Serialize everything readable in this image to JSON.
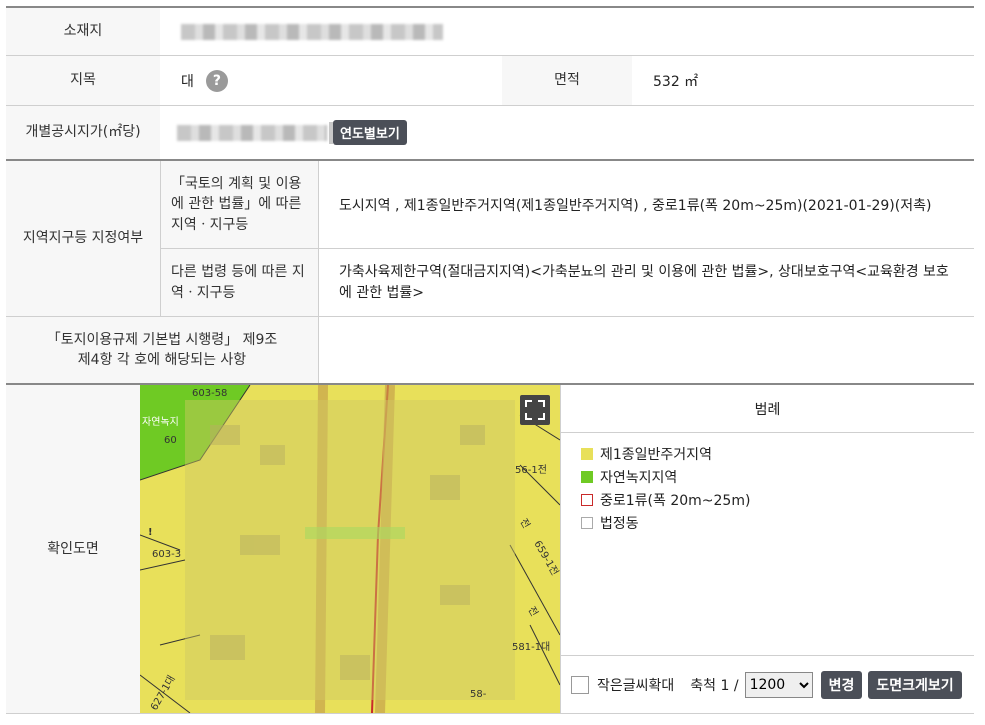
{
  "rows": {
    "location": {
      "label": "소재지"
    },
    "land_category": {
      "label": "지목",
      "value": "대",
      "help_symbol": "?"
    },
    "area": {
      "label": "면적",
      "value": "532 ㎡"
    },
    "official_price": {
      "label": "개별공시지가(㎡당)",
      "button": "연도별보기"
    },
    "zoning": {
      "label": "지역지구등 지정여부",
      "national_label": "「국토의 계획 및 이용에 관한 법률」에 따른 지역ㆍ지구등",
      "national_value": "도시지역 , 제1종일반주거지역(제1종일반주거지역) , 중로1류(폭 20m~25m)(2021-01-29)(저촉)",
      "other_label": "다른 법령 등에 따른 지역ㆍ지구등",
      "other_value": "가축사육제한구역(절대금지지역)<가축분뇨의 관리 및 이용에 관한 법률>, 상대보호구역<교육환경 보호에 관한 법률>"
    },
    "enforcement": {
      "label": "「토지이용규제 기본법 시행령」 제9조 제4항 각 호에 해당되는 사항"
    },
    "map": {
      "label": "확인도면"
    }
  },
  "map_labels": {
    "l1": "603-58",
    "l2": "자연녹지",
    "l3": "60",
    "l4": "603-3",
    "l5": "56-1전",
    "l6": "전",
    "l7": "659-1전",
    "l8": "전",
    "l9": "581-1대",
    "l10": "627-1대",
    "l11": "58-"
  },
  "legend": {
    "title": "범례",
    "items": [
      {
        "label": "제1종일반주거지역",
        "fill": "#e8e05a",
        "border": "#e8e05a"
      },
      {
        "label": "자연녹지지역",
        "fill": "#6fca24",
        "border": "#6fca24"
      },
      {
        "label": "중로1류(폭 20m~25m)",
        "fill": "#ffffff",
        "border": "#c92a2a"
      },
      {
        "label": "법정동",
        "fill": "#ffffff",
        "border": "#aaaaaa"
      }
    ]
  },
  "controls": {
    "enlarge_label": "작은글씨확대",
    "scale_label": "축척 1 /",
    "scale_value": "1200",
    "scale_options": [
      "1200"
    ],
    "change_button": "변경",
    "big_map_button": "도면크게보기"
  },
  "colors": {
    "zone_yellow": "#e8e05a",
    "zone_green": "#6fca24",
    "road_red": "#c92a2a"
  }
}
